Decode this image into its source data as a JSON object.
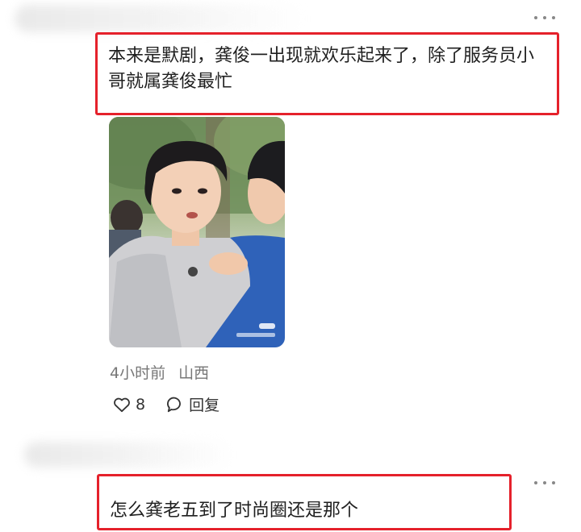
{
  "comments": [
    {
      "text": "本来是默剧，龚俊一出现就欢乐起来了，除了服务员小哥就属龚俊最忙",
      "time": "4小时前",
      "location": "山西",
      "likes": "8",
      "reply_label": "回复",
      "icons": [
        "more-icon",
        "heart-icon",
        "comment-bubble-icon"
      ]
    },
    {
      "text": "怎么龚老五到了时尚圈还是那个",
      "icons": [
        "more-icon"
      ]
    }
  ],
  "colors": {
    "highlight": "#e5212b",
    "meta_text": "#777777",
    "text": "#1f1f1f"
  }
}
